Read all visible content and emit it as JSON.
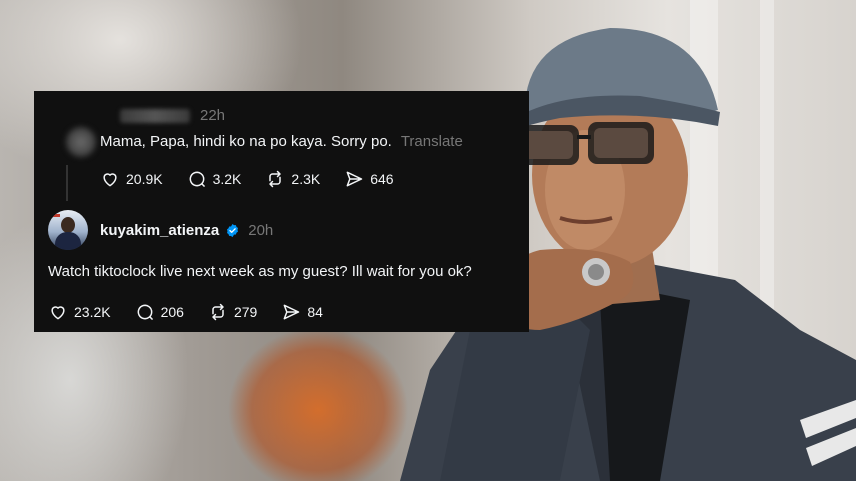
{
  "comment": {
    "timestamp": "22h",
    "text": "Mama, Papa, hindi ko na po kaya. Sorry po.",
    "translate_label": "Translate",
    "likes": "20.9K",
    "replies": "3.2K",
    "reposts": "2.3K",
    "shares": "646"
  },
  "reply": {
    "username": "kuyakim_atienza",
    "timestamp": "20h",
    "text": "Watch tiktoclock live next week as my guest? Ill wait for you ok?",
    "likes": "23.2K",
    "replies": "206",
    "reposts": "279",
    "shares": "84"
  },
  "colors": {
    "card_bg": "#101010",
    "text_primary": "#f3f5f7",
    "text_muted": "#777777",
    "verified_blue": "#0095f6"
  }
}
